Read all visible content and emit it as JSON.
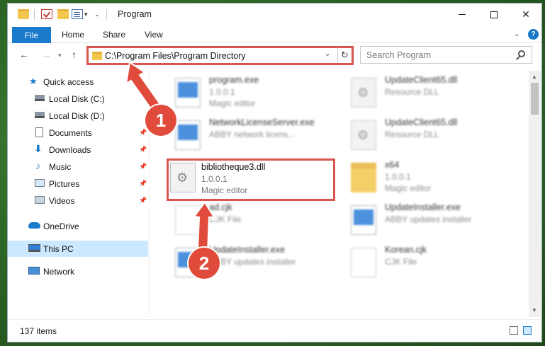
{
  "window": {
    "title": "Program",
    "controls": {
      "minimize": "minimize",
      "maximize": "maximize",
      "close": "✕"
    }
  },
  "ribbon": {
    "tabs": [
      "File",
      "Home",
      "Share",
      "View"
    ]
  },
  "nav": {
    "back": "←",
    "forward": "→",
    "recent": "▾",
    "up": "↑",
    "address": "C:\\Program Files\\Program Directory",
    "refresh": "↻",
    "dropdown": "⌄",
    "search_placeholder": "Search Program"
  },
  "sidebar": {
    "items": [
      {
        "label": "Quick access",
        "icon": "star-icon"
      },
      {
        "label": "Local Disk (C:)",
        "icon": "drive-icon"
      },
      {
        "label": "Local Disk (D:)",
        "icon": "drive-icon"
      },
      {
        "label": "Documents",
        "icon": "documents-icon",
        "pinned": true
      },
      {
        "label": "Downloads",
        "icon": "download-icon",
        "pinned": true
      },
      {
        "label": "Music",
        "icon": "music-icon",
        "pinned": true
      },
      {
        "label": "Pictures",
        "icon": "pictures-icon",
        "pinned": true
      },
      {
        "label": "Videos",
        "icon": "videos-icon",
        "pinned": true
      },
      {
        "label": "OneDrive",
        "icon": "cloud-icon"
      },
      {
        "label": "This PC",
        "icon": "computer-icon",
        "selected": true
      },
      {
        "label": "Network",
        "icon": "network-icon"
      }
    ],
    "pin_glyph": "📌"
  },
  "files": [
    {
      "name": "program.exe",
      "line2": "1.0.0.1",
      "line3": "Magic editor",
      "icon": "exe-icon"
    },
    {
      "name": "UpdateClient65.dll",
      "line2": "Resource DLL",
      "line3": "",
      "icon": "dll-icon"
    },
    {
      "name": "NetworkLicenseServer.exe",
      "line2": "ABBY network licens...",
      "line3": "",
      "icon": "exe-icon"
    },
    {
      "name": "UpdateClient65.dll",
      "line2": "Resource DLL",
      "line3": "",
      "icon": "dll-icon"
    },
    {
      "name": "bibliotheque3.dll",
      "line2": "1.0.0.1",
      "line3": "Magic editor",
      "icon": "dll-icon"
    },
    {
      "name": "x64",
      "line2": "1.0.0.1",
      "line3": "Magic editor",
      "icon": "folder-icon"
    },
    {
      "name": "ad.cjk",
      "line2": "CJK File",
      "line3": "",
      "icon": "doc-icon"
    },
    {
      "name": "UpdateInstaller.exe",
      "line2": "ABBY updates installer",
      "line3": "",
      "icon": "exe-icon"
    },
    {
      "name": "UpdateInstaller.exe",
      "line2": "ABBY updates installer",
      "line3": "",
      "icon": "exe-icon"
    },
    {
      "name": "Korean.cjk",
      "line2": "CJK File",
      "line3": "",
      "icon": "doc-icon"
    }
  ],
  "status": {
    "items": "137 items"
  },
  "annotations": {
    "step1": "1",
    "step2": "2",
    "color": "#e14b3b"
  }
}
